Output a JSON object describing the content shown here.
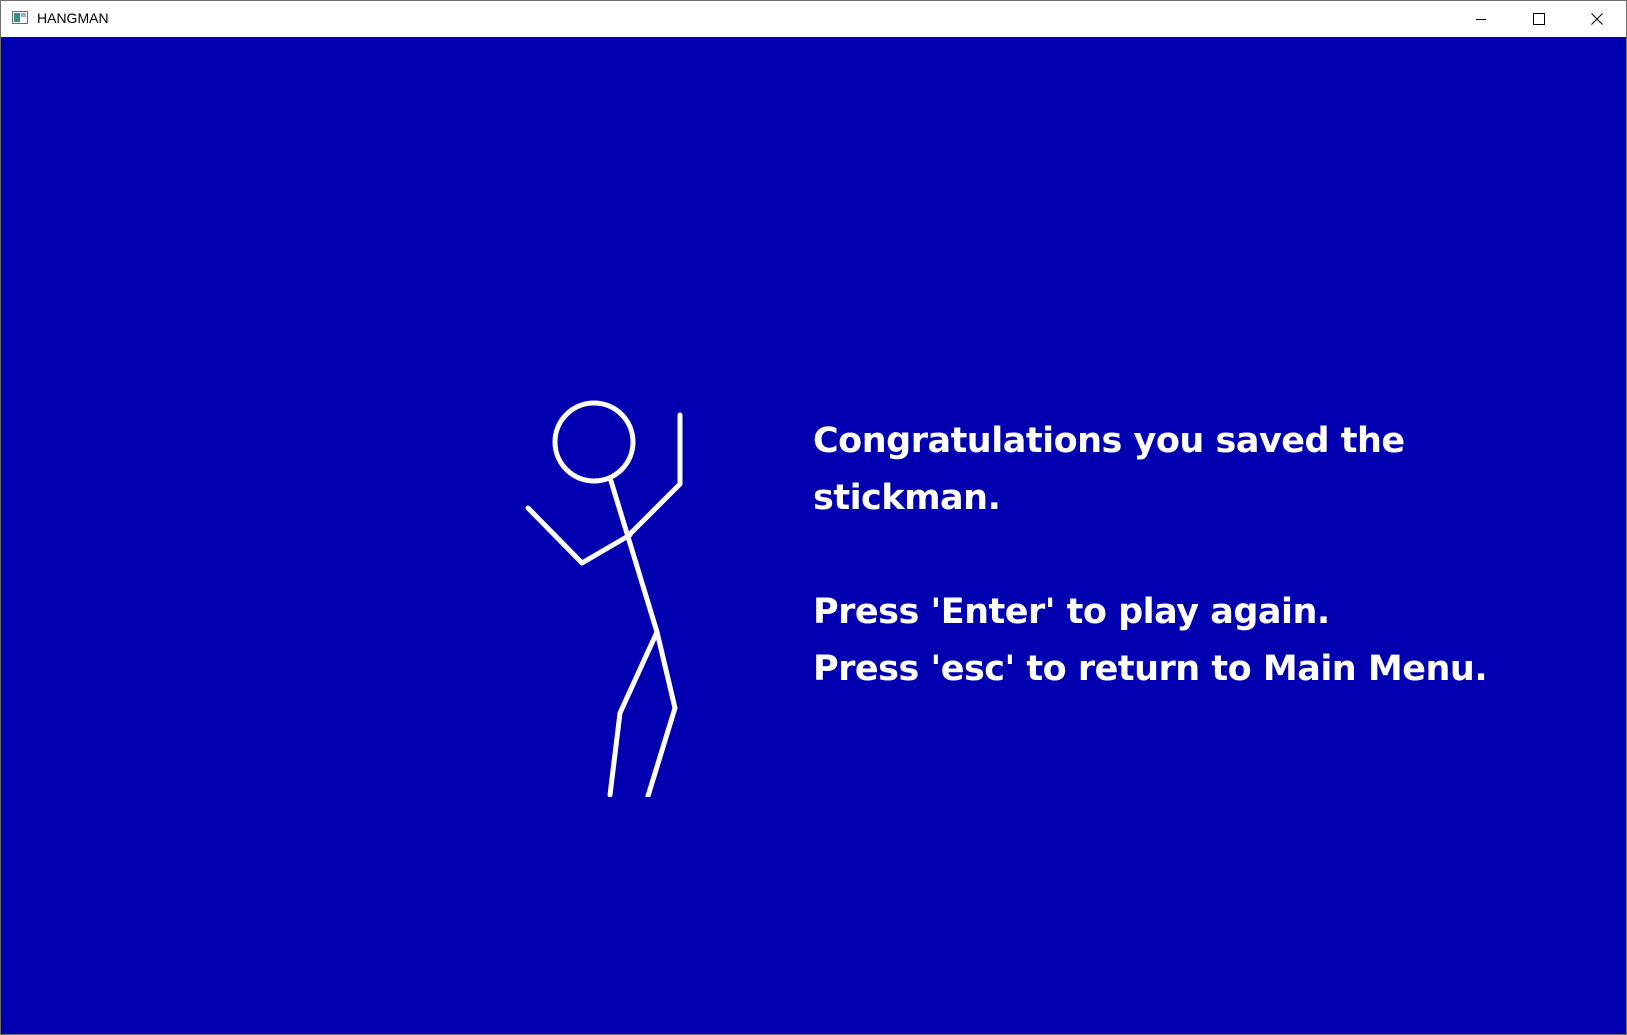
{
  "window": {
    "title": "HANGMAN",
    "controls": {
      "minimize_icon": "minimize-icon",
      "maximize_icon": "maximize-icon",
      "close_icon": "close-icon"
    }
  },
  "game": {
    "background_color": "#0000b0",
    "figure_color": "#ffffff",
    "message": {
      "line1": "Congratulations you saved the",
      "line2": "stickman.",
      "line3": "Press 'Enter' to play again.",
      "line4": "Press 'esc' to return to Main Menu."
    }
  }
}
